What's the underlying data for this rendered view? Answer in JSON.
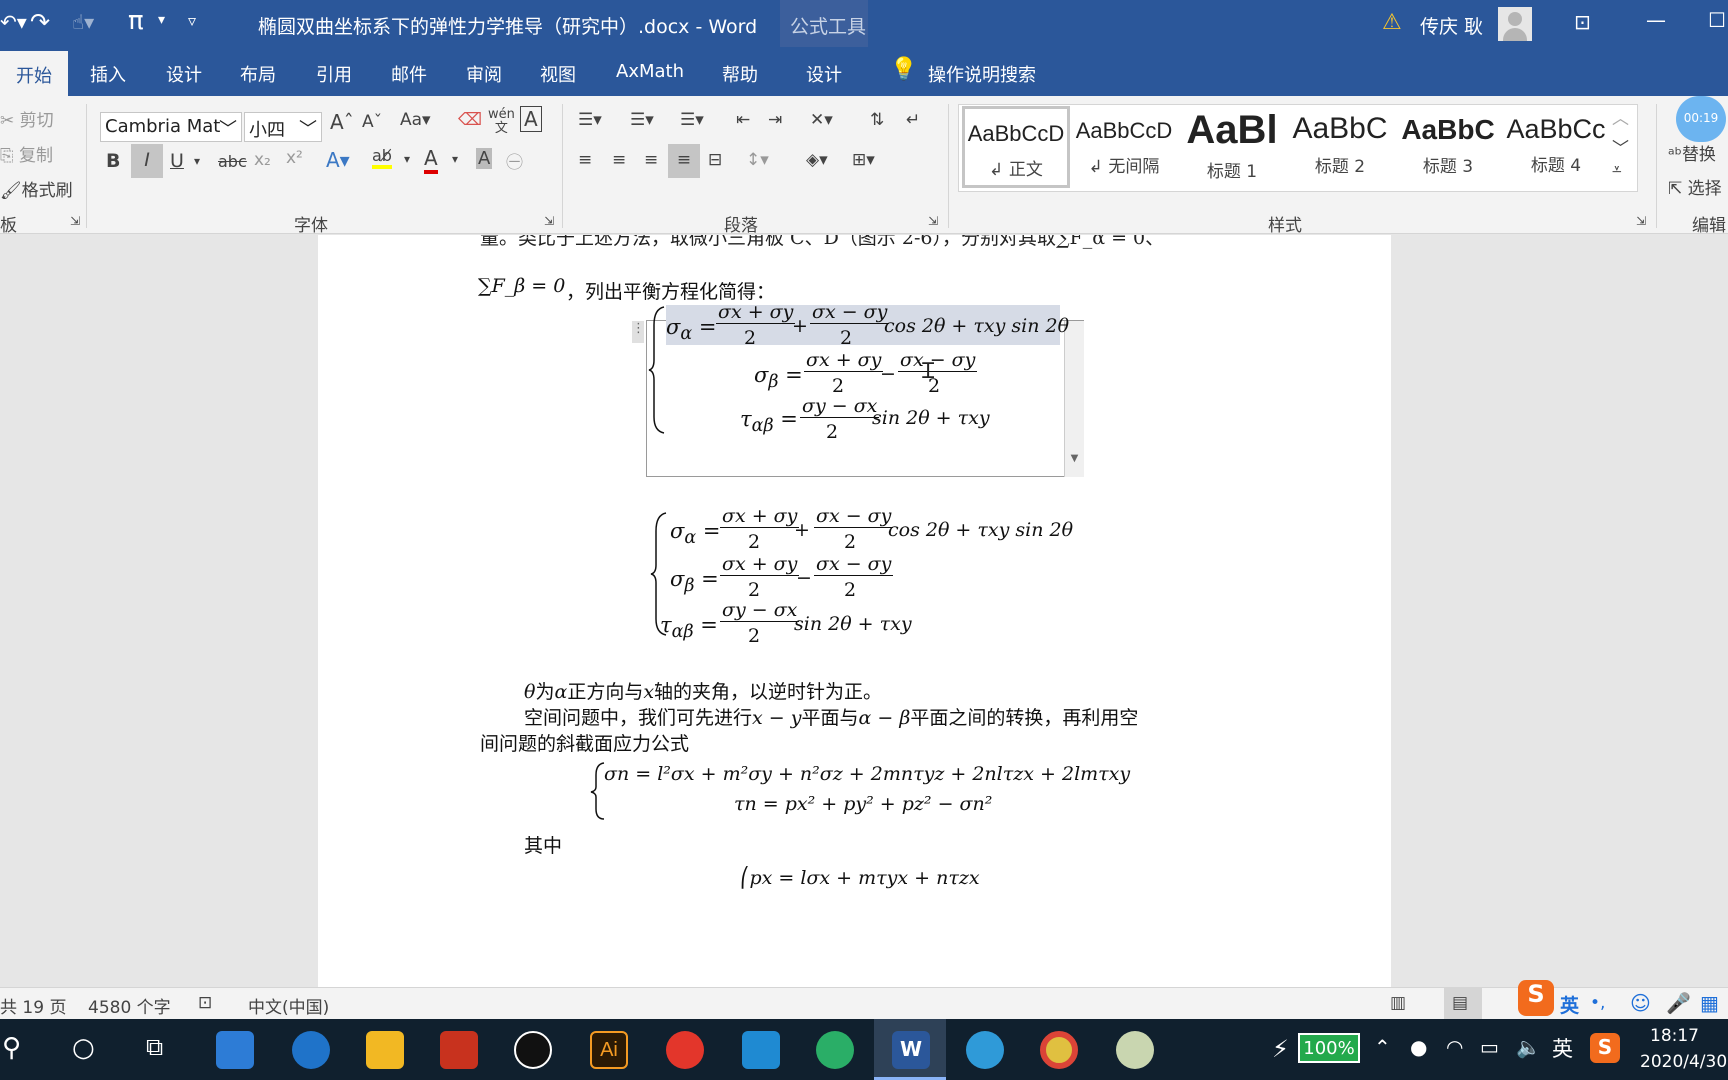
{
  "titlebar": {
    "doc_title": "椭圆双曲坐标系下的弹性力学推导（研究中）.docx - Word",
    "context_tab": "公式工具",
    "user": "传庆 耿",
    "pi": "π"
  },
  "tabs": [
    "开始",
    "插入",
    "设计",
    "布局",
    "引用",
    "邮件",
    "审阅",
    "视图",
    "AxMath",
    "帮助",
    "设计"
  ],
  "tell_me": "操作说明搜索",
  "clipboard": {
    "cut": "剪切",
    "copy": "复制",
    "format_painter": "格式刷",
    "group": "板"
  },
  "font": {
    "name": "Cambria Mat",
    "size": "小四",
    "group": "字体",
    "bold": "B",
    "italic": "I",
    "underline": "U",
    "strike": "abc",
    "sub": "x₂",
    "sup": "x²",
    "grow": "A",
    "shrink": "A",
    "case": "Aa",
    "pinyin": "wén\n文"
  },
  "paragraph": {
    "group": "段落"
  },
  "styles": {
    "group": "样式",
    "items": [
      {
        "preview": "AaBbCcD",
        "name": "↲ 正文"
      },
      {
        "preview": "AaBbCcD",
        "name": "↲ 无间隔"
      },
      {
        "preview": "AaBl",
        "name": "标题 1"
      },
      {
        "preview": "AaBbC",
        "name": "标题 2"
      },
      {
        "preview": "AaBbC",
        "name": "标题 3"
      },
      {
        "preview": "AaBbCc",
        "name": "标题 4"
      }
    ]
  },
  "editing": {
    "find": "替换",
    "select": "选择",
    "group": "编辑",
    "timer": "00:19"
  },
  "doc": {
    "line_top": "量。类比于上述方法，取微小三角板 C、D（图示 2-6），分别对其取∑F_α = 0、",
    "line2_math": "∑F_β = 0",
    "line2_text": "，列出平衡方程化简得：",
    "para1_a": "θ",
    "para1_b": "为",
    "para1_c": "α",
    "para1_d": "正方向与",
    "para1_e": "x",
    "para1_f": "轴的夹角，以逆时针为正。",
    "para2": "空间问题中，我们可先进行",
    "para2_m1": "x − y",
    "para2_b": "平面与",
    "para2_m2": "α − β",
    "para2_c": "平面之间的转换，再利用空",
    "para3": "间问题的斜截面应力公式",
    "qizhong": "其中"
  },
  "eq": {
    "sa": "σ",
    "a": "α",
    "eq": "=",
    "sx": "σx + σy",
    "sxm": "σx − σy",
    "two": "2",
    "plus": "+",
    "minus": "−",
    "cos": "cos 2θ + τxy sin 2θ",
    "sin": "sin 2θ + τxy",
    "tab": "τ",
    "ab": "αβ",
    "b": "β",
    "syx": "σy − σx",
    "n1": "σn = l²σx + m²σy + n²σz + 2mnτyz + 2nlτzx + 2lmτxy",
    "n2": "τn = px² + py² + pz² − σn²",
    "px": "px = lσx + mτyx + nτzx"
  },
  "status": {
    "pages": "共 19 页",
    "words": "4580 个字",
    "lang": "中文(中国)"
  },
  "taskbar": {
    "battery": "100%",
    "ime": "英",
    "time": "18:17",
    "date": "2020/4/30"
  }
}
